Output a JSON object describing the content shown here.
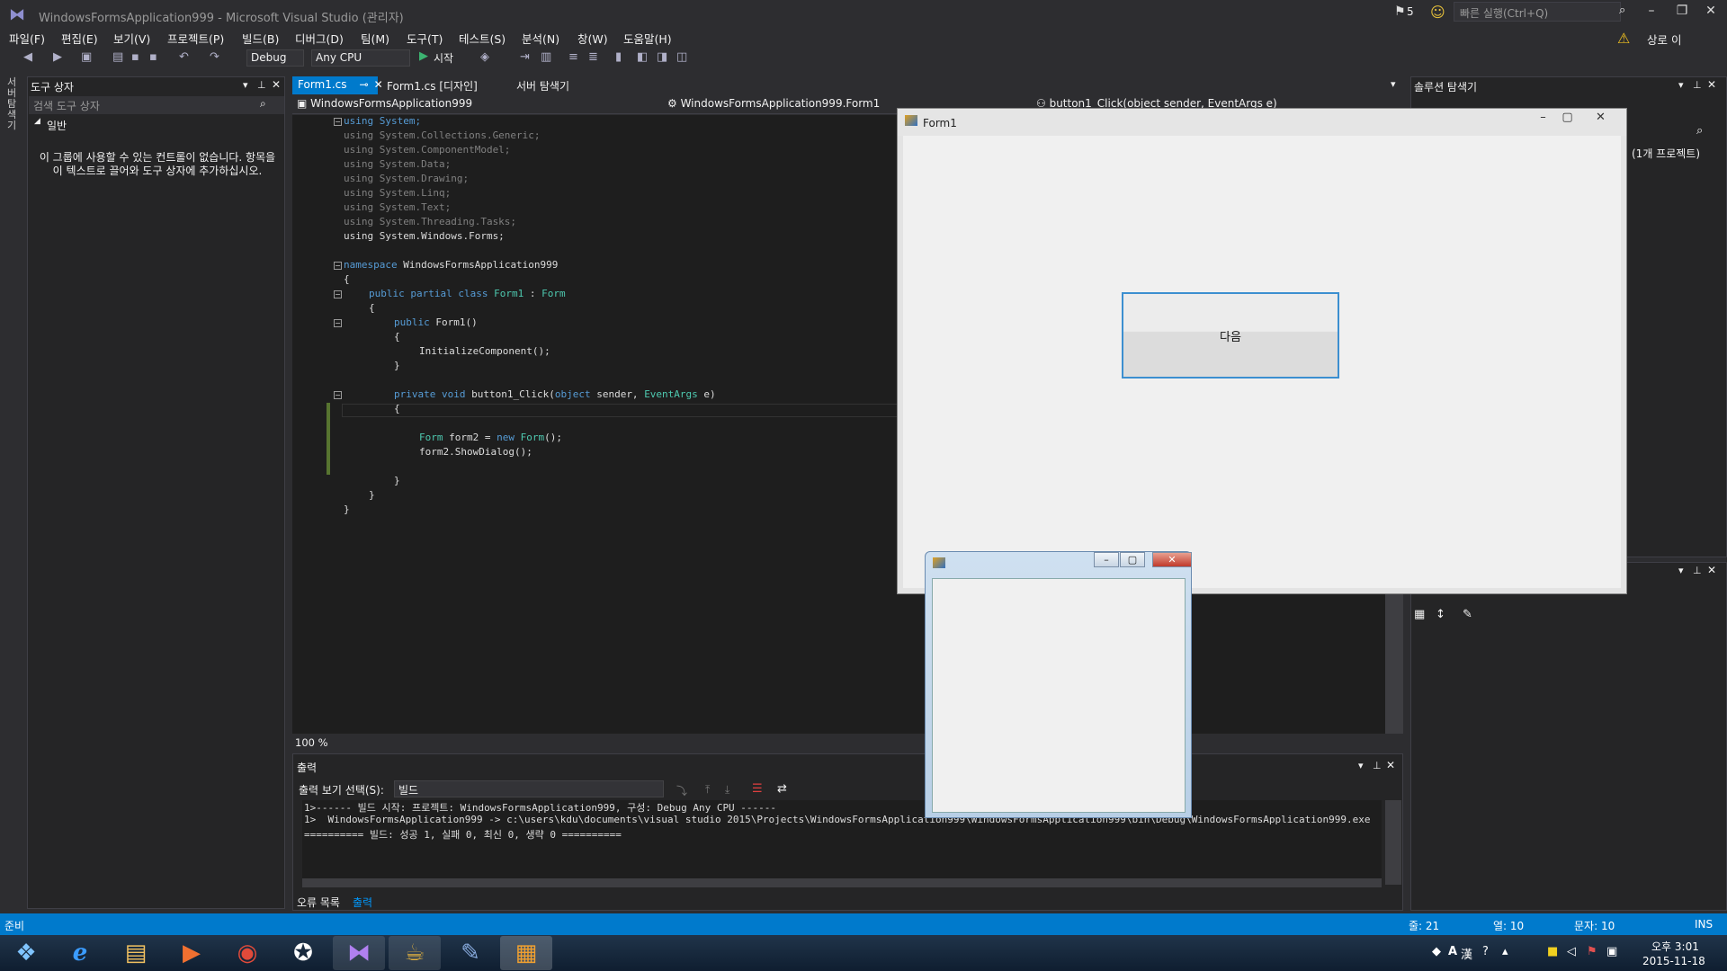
{
  "window": {
    "title": "WindowsFormsApplication999 - Microsoft Visual Studio (관리자)",
    "notification_count": "5",
    "quick_launch_placeholder": "빠른 실행(Ctrl+Q)",
    "user": "상로 이"
  },
  "menu": [
    "파일(F)",
    "편집(E)",
    "보기(V)",
    "프로젝트(P)",
    "빌드(B)",
    "디버그(D)",
    "팀(M)",
    "도구(T)",
    "테스트(S)",
    "분석(N)",
    "창(W)",
    "도움말(H)"
  ],
  "toolbar": {
    "config": "Debug",
    "platform": "Any CPU",
    "start": "시작"
  },
  "left_strip": {
    "label": "서버 탐색기"
  },
  "toolbox": {
    "title": "도구 상자",
    "search_placeholder": "검색 도구 상자",
    "group": "일반",
    "empty_message": "이 그룹에 사용할 수 있는 컨트롤이 없습니다. 항목을 이 텍스트로 끌어와 도구 상자에 추가하십시오."
  },
  "tabs": [
    {
      "label": "Form1.cs"
    },
    {
      "label": "Form1.cs [디자인]"
    },
    {
      "label": "서버 탐색기"
    }
  ],
  "navbar": {
    "project": "WindowsFormsApplication999",
    "class": "WindowsFormsApplication999.Form1",
    "member": "button1_Click(object sender, EventArgs e)"
  },
  "code": {
    "l1": "using System;",
    "l2": "using System.Collections.Generic;",
    "l3": "using System.ComponentModel;",
    "l4": "using System.Data;",
    "l5": "using System.Drawing;",
    "l6": "using System.Linq;",
    "l7": "using System.Text;",
    "l8": "using System.Threading.Tasks;",
    "l9": "using System.Windows.Forms;",
    "ns_kw": "namespace",
    "ns_name": " WindowsFormsApplication999",
    "brace_open": "{",
    "brace_close": "}",
    "cls_kw": "public partial class",
    "cls_name": " Form1",
    "cls_sep": " : ",
    "cls_base": "Form",
    "ctor_kw": "public",
    "ctor_name": " Form1()",
    "init": "InitializeComponent();",
    "m_kw": "private void",
    "m_name": " button1_Click(",
    "m_obj": "object",
    "m_mid": " sender, ",
    "m_args": "EventArgs",
    "m_end": " e)",
    "f_type": "Form",
    "f_mid": " form2 = ",
    "f_new": "new",
    "f_sp": " ",
    "f_form": "Form",
    "f_end": "();",
    "show": "form2.ShowDialog();"
  },
  "zoom": "100 %",
  "output": {
    "title": "출력",
    "source_label": "출력 보기 선택(S):",
    "source": "빌드",
    "lines": [
      "1>------ 빌드 시작: 프로젝트: WindowsFormsApplication999, 구성: Debug Any CPU ------",
      "1>  WindowsFormsApplication999 -> c:\\users\\kdu\\documents\\visual studio 2015\\Projects\\WindowsFormsApplication999\\WindowsFormsApplication999\\bin\\Debug\\WindowsFormsApplication999.exe",
      "========== 빌드: 성공 1, 실패 0, 최신 0, 생략 0 =========="
    ],
    "tabs": [
      "오류 목록",
      "출력"
    ]
  },
  "solution_explorer": {
    "title": "솔루션 탐색기",
    "project_count": "(1개 프로젝트)"
  },
  "status": {
    "ready": "준비",
    "line": "줄: 21",
    "col": "열: 10",
    "char": "문자: 10",
    "mode": "INS"
  },
  "form1": {
    "title": "Form1",
    "button": "다음"
  },
  "clock": {
    "time": "오후 3:01",
    "date": "2015-11-18"
  }
}
